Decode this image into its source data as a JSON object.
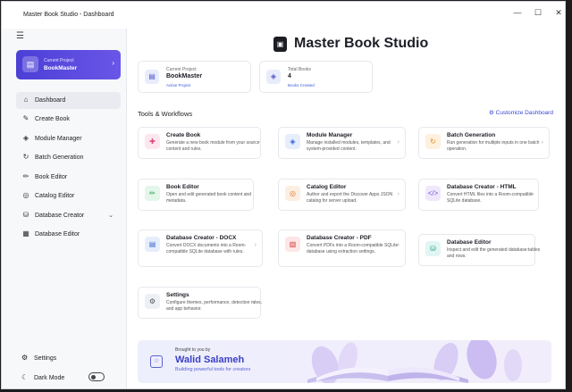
{
  "window": {
    "title": "Master Book Studio - Dashboard",
    "min": "—",
    "max": "☐",
    "close": "✕"
  },
  "sidebar": {
    "project": {
      "label": "Current Project",
      "name": "BookMaster"
    },
    "items": [
      {
        "label": "Dashboard",
        "icon": "home-icon"
      },
      {
        "label": "Create Book",
        "icon": "create-book-icon"
      },
      {
        "label": "Module Manager",
        "icon": "layers-icon"
      },
      {
        "label": "Batch Generation",
        "icon": "refresh-icon"
      },
      {
        "label": "Book Editor",
        "icon": "pencil-icon"
      },
      {
        "label": "Catalog Editor",
        "icon": "globe-icon"
      },
      {
        "label": "Database Creator",
        "icon": "database-icon"
      },
      {
        "label": "Database Editor",
        "icon": "table-icon"
      }
    ],
    "settings": "Settings",
    "dark_mode": "Dark Mode"
  },
  "header": {
    "title": "Master Book Studio"
  },
  "stats": [
    {
      "label": "Current Project",
      "value": "BookMaster",
      "sub": "Active Project"
    },
    {
      "label": "Total Books",
      "value": "4",
      "sub": "Books Created"
    }
  ],
  "tools": {
    "title": "Tools & Workflows",
    "customize": "Customize Dashboard"
  },
  "cards": [
    {
      "title": "Create Book",
      "desc": "Generate a new book module from your source content and rules."
    },
    {
      "title": "Module Manager",
      "desc": "Manage installed modules, templates, and system-provided content."
    },
    {
      "title": "Batch Generation",
      "desc": "Run generation for multiple inputs in one batch operation."
    },
    {
      "title": "Book Editor",
      "desc": "Open and edit generated book content and metadata."
    },
    {
      "title": "Catalog Editor",
      "desc": "Author and export the Discover Apps JSON catalog for server upload."
    },
    {
      "title": "Database Creator - HTML",
      "desc": "Convert HTML files into a Room-compatible SQLite database."
    },
    {
      "title": "Database Creator - DOCX",
      "desc": "Convert DOCX documents into a Room-compatible SQLite database with rules."
    },
    {
      "title": "Database Creator - PDF",
      "desc": "Convert PDFs into a Room-compatible SQLite database using extraction settings."
    },
    {
      "title": "Database Editor",
      "desc": "Inspect and edit the generated database tables and rows."
    },
    {
      "title": "Settings",
      "desc": "Configure themes, performance, detection rules, and app behavior."
    }
  ],
  "banner": {
    "line1": "Brought to you by",
    "name": "Walid Salameh",
    "tagline": "Building powerful tools for creators"
  }
}
